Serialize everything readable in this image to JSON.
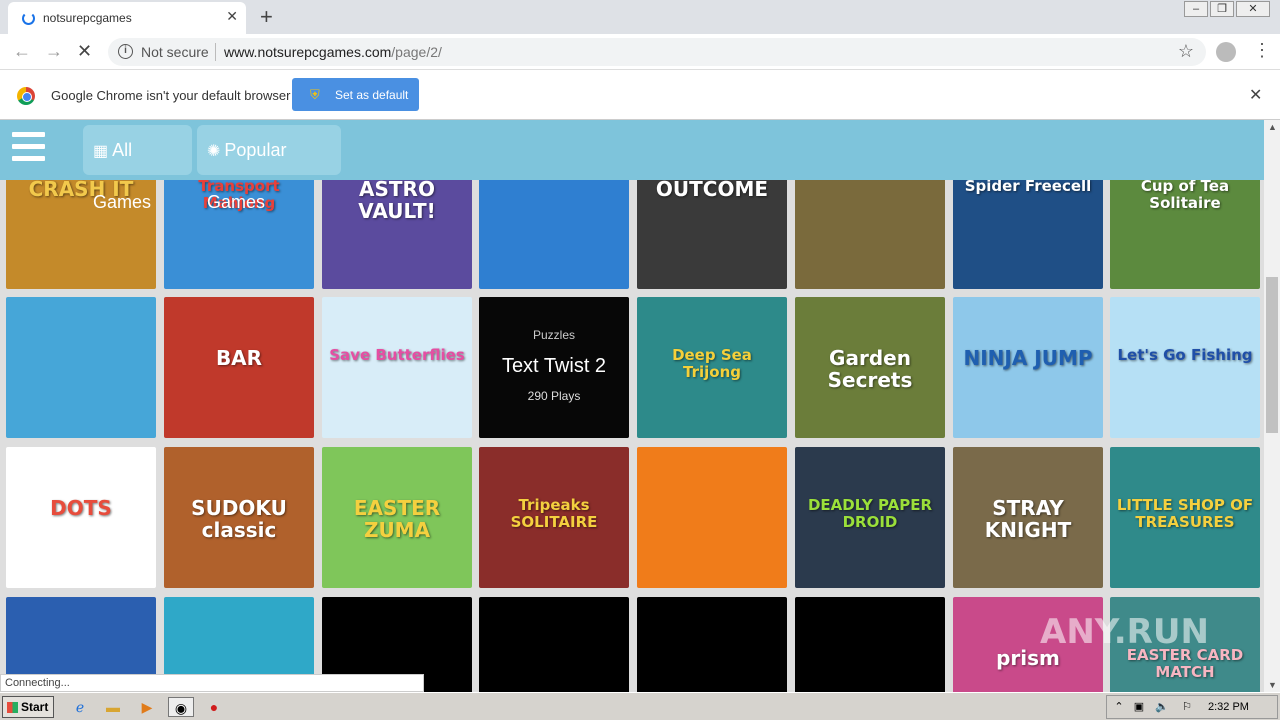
{
  "browser": {
    "tab_title": "notsurepcgames",
    "new_tab": "+",
    "close_glyph": "✕",
    "not_secure": "Not secure",
    "url_host": "www.notsurepcgames.com",
    "url_path": "/page/2/",
    "info_bar_text": "Google Chrome isn't your default browser",
    "set_default_label": "Set as default"
  },
  "site": {
    "nav": [
      {
        "label": "All Games",
        "icon": "grid-icon"
      },
      {
        "label": "Popular Games",
        "icon": "sun-icon"
      }
    ]
  },
  "games": [
    {
      "title": "CRASH IT",
      "bg": "#c48a2a",
      "fg": "#f2c94c"
    },
    {
      "title": "Transport Mahjong",
      "bg": "#3a8fd6",
      "fg": "#e8403a"
    },
    {
      "title": "ASTRO VAULT!",
      "bg": "#5b4b9e",
      "fg": "#ffffff"
    },
    {
      "title": "",
      "bg": "#2f7fd1",
      "fg": "#ffffff"
    },
    {
      "title": "OUTCOME",
      "bg": "#3a3a3a",
      "fg": "#ffffff"
    },
    {
      "title": "",
      "bg": "#7a6a3c",
      "fg": "#ffffff"
    },
    {
      "title": "Spider Freecell",
      "bg": "#1f4f86",
      "fg": "#ffffff"
    },
    {
      "title": "Cup of Tea Solitaire",
      "bg": "#5c8a3e",
      "fg": "#ffffff"
    },
    {
      "title": "",
      "bg": "#46a6d8",
      "fg": "#ffffff"
    },
    {
      "title": "BAR",
      "bg": "#c0392b",
      "fg": "#ffffff"
    },
    {
      "title": "Save Butterflies",
      "bg": "#d8edf8",
      "fg": "#e54ea3"
    },
    {
      "title": "Text Twist 2",
      "bg": "#2a2a2a",
      "fg": "#ffffff"
    },
    {
      "title": "Deep Sea Trijong",
      "bg": "#2d8a8a",
      "fg": "#f5d03a"
    },
    {
      "title": "Garden Secrets",
      "bg": "#6b7d3a",
      "fg": "#ffffff"
    },
    {
      "title": "NINJA JUMP",
      "bg": "#8ec8ea",
      "fg": "#1f5fb0"
    },
    {
      "title": "Let's Go Fishing",
      "bg": "#b6e0f5",
      "fg": "#1f4fa8"
    },
    {
      "title": "DOTS",
      "bg": "#ffffff",
      "fg": "#e74c3c"
    },
    {
      "title": "SUDOKU classic",
      "bg": "#b0612c",
      "fg": "#ffffff"
    },
    {
      "title": "EASTER ZUMA",
      "bg": "#7fc65a",
      "fg": "#f4d03f"
    },
    {
      "title": "Tripeaks SOLITAIRE",
      "bg": "#8a2d2a",
      "fg": "#f4d03f"
    },
    {
      "title": "",
      "bg": "#f07c1a",
      "fg": "#ffffff"
    },
    {
      "title": "DEADLY PAPER DROID",
      "bg": "#2b3a4d",
      "fg": "#9be03a"
    },
    {
      "title": "STRAY KNIGHT",
      "bg": "#7a6a4a",
      "fg": "#ffffff"
    },
    {
      "title": "LITTLE SHOP OF TREASURES",
      "bg": "#2f8a8a",
      "fg": "#f4d03f"
    },
    {
      "title": "",
      "bg": "#2b5fb0",
      "fg": "#ffffff"
    },
    {
      "title": "",
      "bg": "#2fa8c8",
      "fg": "#ffffff"
    },
    {
      "title": "",
      "bg": "#000000",
      "fg": "#ffffff"
    },
    {
      "title": "",
      "bg": "#000000",
      "fg": "#ffffff"
    },
    {
      "title": "",
      "bg": "#000000",
      "fg": "#ffffff"
    },
    {
      "title": "",
      "bg": "#000000",
      "fg": "#ffffff"
    },
    {
      "title": "prism",
      "bg": "#c94a8a",
      "fg": "#ffffff"
    },
    {
      "title": "EASTER CARD MATCH",
      "bg": "#3f8a8a",
      "fg": "#f7b6c2"
    }
  ],
  "hover": {
    "category": "Puzzles",
    "name": "Text Twist 2",
    "plays": "290 Plays"
  },
  "status_text": "Connecting...",
  "watermark": "ANY.RUN",
  "taskbar": {
    "start": "Start",
    "clock": "2:32 PM"
  }
}
